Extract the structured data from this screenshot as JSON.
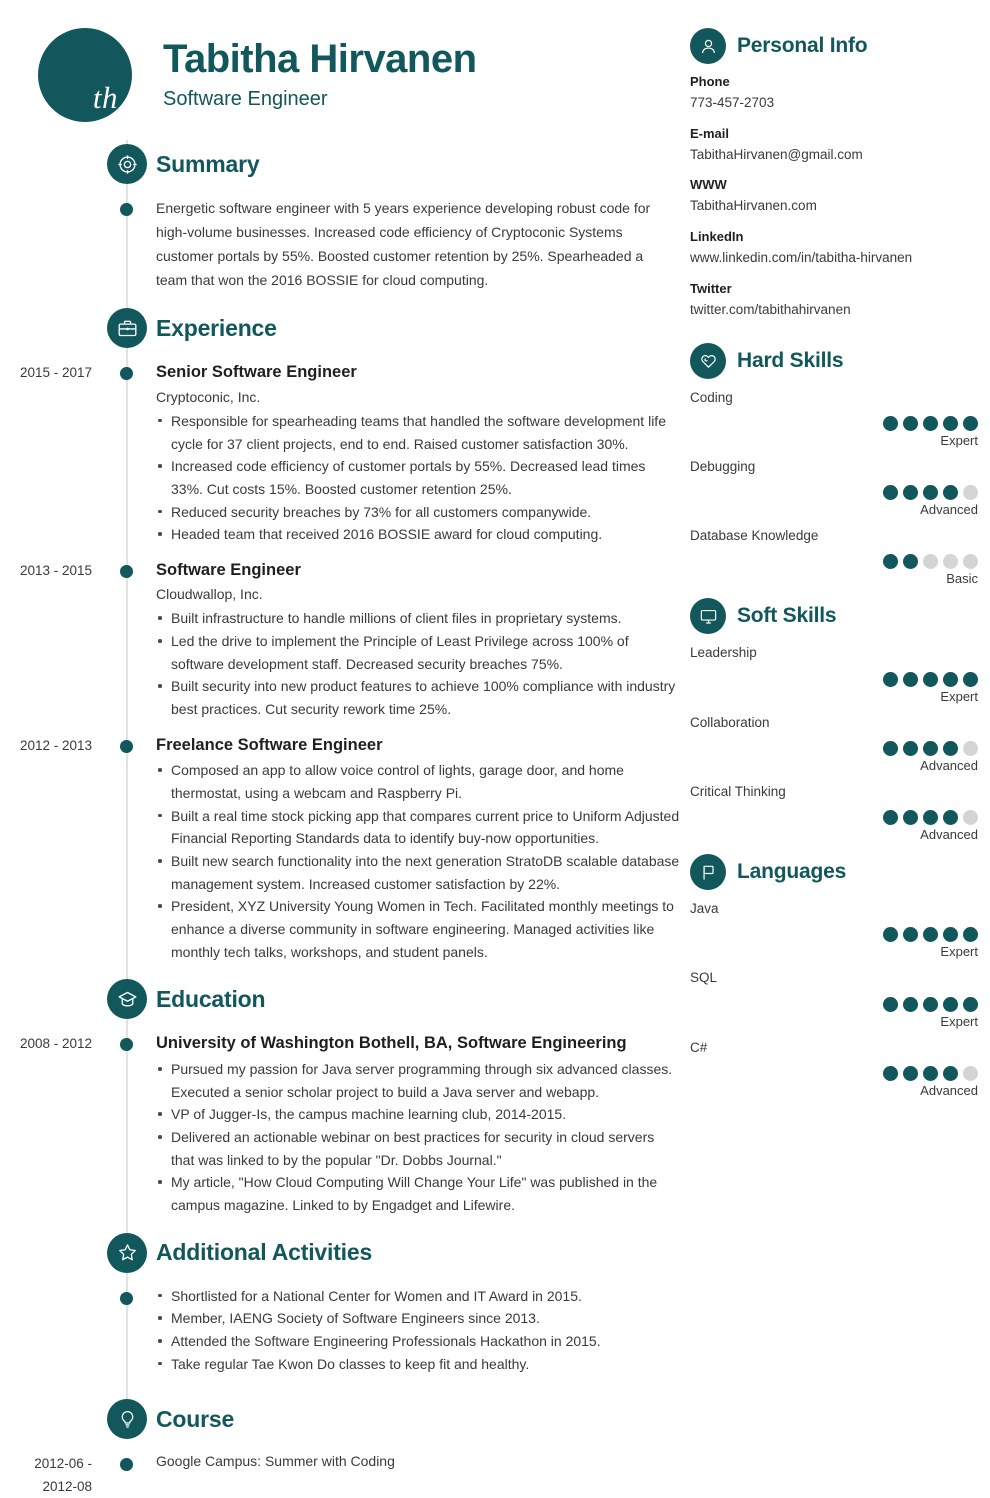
{
  "profile": {
    "initials": "th",
    "name": "Tabitha Hirvanen",
    "title": "Software Engineer"
  },
  "theme": {
    "accent": "#11575c",
    "text": "#3a3a3a",
    "dot_off": "#d5d5d5",
    "rail": "#e2e2e2"
  },
  "left": {
    "summary": {
      "heading": "Summary",
      "icon": "target-icon",
      "text": "Energetic software engineer with 5 years experience developing robust code for high-volume businesses. Increased code efficiency of Cryptoconic Systems customer portals by 55%. Boosted customer retention by 25%. Spearheaded a team that won the 2016 BOSSIE for cloud computing."
    },
    "experience": {
      "heading": "Experience",
      "icon": "briefcase-icon",
      "entries": [
        {
          "date": "2015 - 2017",
          "title": "Senior Software Engineer",
          "company": "Cryptoconic, Inc.",
          "bullets": [
            "Responsible for spearheading teams that handled the software development life cycle for 37 client projects, end to end. Raised customer satisfaction 30%.",
            "Increased code efficiency of customer portals by 55%. Decreased lead times 33%. Cut costs 15%. Boosted customer retention 25%.",
            "Reduced security breaches by 73% for all customers companywide.",
            "Headed team that received 2016 BOSSIE award for cloud computing."
          ]
        },
        {
          "date": "2013 - 2015",
          "title": "Software Engineer",
          "company": "Cloudwallop, Inc.",
          "bullets": [
            "Built infrastructure to handle millions of client files in proprietary systems.",
            "Led the drive to implement the Principle of Least Privilege across 100% of software development staff. Decreased security breaches 75%.",
            "Built security into new product features to achieve 100% compliance with industry best practices. Cut security rework time 25%."
          ]
        },
        {
          "date": "2012 - 2013",
          "title": "Freelance Software Engineer",
          "company": "",
          "bullets": [
            "Composed an app to allow voice control of lights, garage door, and home thermostat, using a webcam and Raspberry Pi.",
            "Built a real time stock picking app that compares current price to Uniform Adjusted Financial Reporting Standards data to identify buy-now opportunities.",
            "Built new search functionality into the next generation StratoDB scalable database management system. Increased customer satisfaction by 22%.",
            "President, XYZ University Young Women in Tech. Facilitated monthly meetings to enhance a diverse community in software engineering. Managed activities like monthly tech talks, workshops, and student panels."
          ]
        }
      ]
    },
    "education": {
      "heading": "Education",
      "icon": "graduation-cap-icon",
      "entries": [
        {
          "date": "2008 - 2012",
          "title": "University of Washington Bothell, BA, Software Engineering",
          "company": "",
          "bullets": [
            "Pursued my passion for Java server programming through six advanced classes. Executed a senior scholar project to build a Java server and webapp.",
            "VP of Jugger-Is, the campus machine learning club, 2014-2015.",
            "Delivered an actionable webinar on best practices for security in cloud servers that was linked to by the popular \"Dr. Dobbs Journal.\"",
            "My article, \"How Cloud Computing Will Change Your Life\" was published in the campus magazine. Linked to by Engadget and Lifewire."
          ]
        }
      ]
    },
    "activities": {
      "heading": "Additional Activities",
      "icon": "star-icon",
      "entries": [
        {
          "date": "",
          "title": "",
          "company": "",
          "bullets": [
            "Shortlisted for a National Center for Women and IT Award in 2015.",
            "Member, IAENG Society of Software Engineers since 2013.",
            "Attended the Software Engineering Professionals Hackathon in 2015.",
            "Take regular Tae Kwon Do classes to keep fit and healthy."
          ]
        }
      ]
    },
    "course": {
      "heading": "Course",
      "icon": "lightbulb-icon",
      "entries": [
        {
          "date": "2012-06 - 2012-08",
          "title": "",
          "company": "Google Campus: Summer with Coding",
          "bullets": []
        }
      ]
    }
  },
  "right": {
    "personal_info": {
      "heading": "Personal Info",
      "icon": "person-icon",
      "items": [
        {
          "label": "Phone",
          "value": "773-457-2703"
        },
        {
          "label": "E-mail",
          "value": "TabithaHirvanen@gmail.com"
        },
        {
          "label": "WWW",
          "value": "TabithaHirvanen.com"
        },
        {
          "label": "LinkedIn",
          "value": "www.linkedin.com/in/tabitha-hirvanen"
        },
        {
          "label": "Twitter",
          "value": "twitter.com/tabithahirvanen"
        }
      ]
    },
    "hard_skills": {
      "heading": "Hard Skills",
      "icon": "puzzle-heart-icon",
      "items": [
        {
          "name": "Coding",
          "rating": 5,
          "max": 5,
          "level": "Expert"
        },
        {
          "name": "Debugging",
          "rating": 4,
          "max": 5,
          "level": "Advanced"
        },
        {
          "name": "Database Knowledge",
          "rating": 2,
          "max": 5,
          "level": "Basic"
        }
      ]
    },
    "soft_skills": {
      "heading": "Soft Skills",
      "icon": "monitor-icon",
      "items": [
        {
          "name": "Leadership",
          "rating": 5,
          "max": 5,
          "level": "Expert"
        },
        {
          "name": "Collaboration",
          "rating": 4,
          "max": 5,
          "level": "Advanced"
        },
        {
          "name": "Critical Thinking",
          "rating": 4,
          "max": 5,
          "level": "Advanced"
        }
      ]
    },
    "languages": {
      "heading": "Languages",
      "icon": "flag-icon",
      "items": [
        {
          "name": "Java",
          "rating": 5,
          "max": 5,
          "level": "Expert"
        },
        {
          "name": "SQL",
          "rating": 5,
          "max": 5,
          "level": "Expert"
        },
        {
          "name": "C#",
          "rating": 4,
          "max": 5,
          "level": "Advanced"
        }
      ]
    }
  }
}
